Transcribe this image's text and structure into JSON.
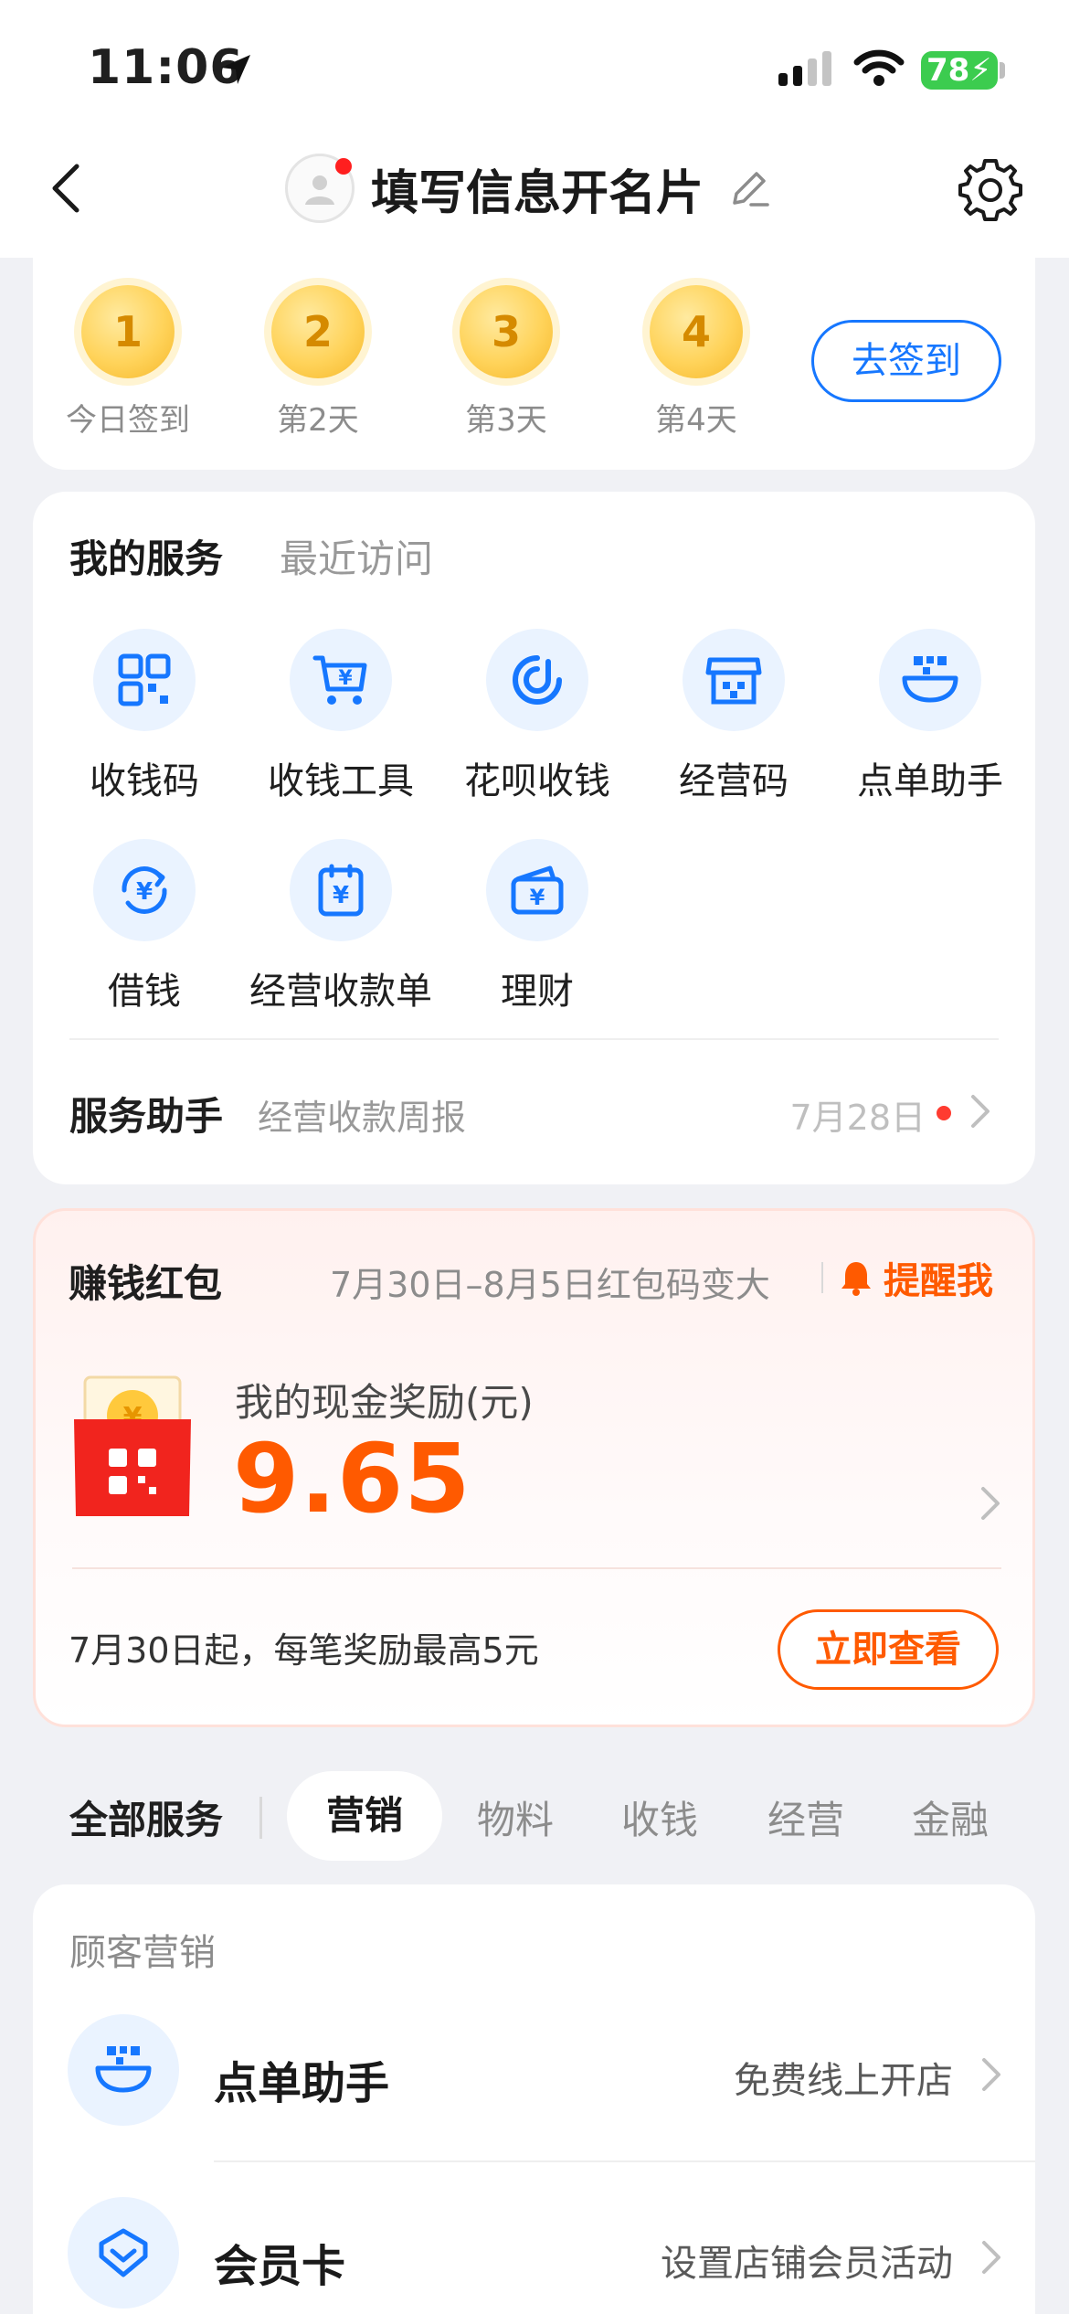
{
  "status_bar": {
    "time": "11:06",
    "battery": "78"
  },
  "nav": {
    "title": "填写信息开名片"
  },
  "signin": {
    "days": [
      {
        "num": "1",
        "label": "今日签到"
      },
      {
        "num": "2",
        "label": "第2天"
      },
      {
        "num": "3",
        "label": "第3天"
      },
      {
        "num": "4",
        "label": "第4天"
      }
    ],
    "button": "去签到"
  },
  "services": {
    "tabs": [
      "我的服务",
      "最近访问"
    ],
    "items": [
      {
        "label": "收钱码",
        "icon": "qr-grid-icon"
      },
      {
        "label": "收钱工具",
        "icon": "cart-yuan-icon"
      },
      {
        "label": "花呗收钱",
        "icon": "huabei-icon"
      },
      {
        "label": "经营码",
        "icon": "store-icon"
      },
      {
        "label": "点单助手",
        "icon": "order-bowl-icon"
      },
      {
        "label": "借钱",
        "icon": "loan-cycle-icon"
      },
      {
        "label": "经营收款单",
        "icon": "receipt-icon"
      },
      {
        "label": "理财",
        "icon": "wallet-icon"
      }
    ],
    "helper": {
      "title": "服务助手",
      "subtitle": "经营收款周报",
      "date": "7月28日"
    }
  },
  "red_packet": {
    "title": "赚钱红包",
    "subtitle": "7月30日–8月5日红包码变大",
    "remind": "提醒我",
    "reward_label": "我的现金奖励(元)",
    "amount": "9.65",
    "note": "7月30日起，每笔奖励最高5元",
    "button": "立即查看"
  },
  "all_services": {
    "title": "全部服务",
    "tabs": [
      "营销",
      "物料",
      "收钱",
      "经营",
      "金融"
    ]
  },
  "marketing": {
    "heading": "顾客营销",
    "rows": [
      {
        "title": "点单助手",
        "desc": "免费线上开店"
      },
      {
        "title": "会员卡",
        "desc": "设置店铺会员活动"
      }
    ]
  },
  "colors": {
    "accent_blue": "#1677ff",
    "accent_orange": "#ff5a00"
  }
}
